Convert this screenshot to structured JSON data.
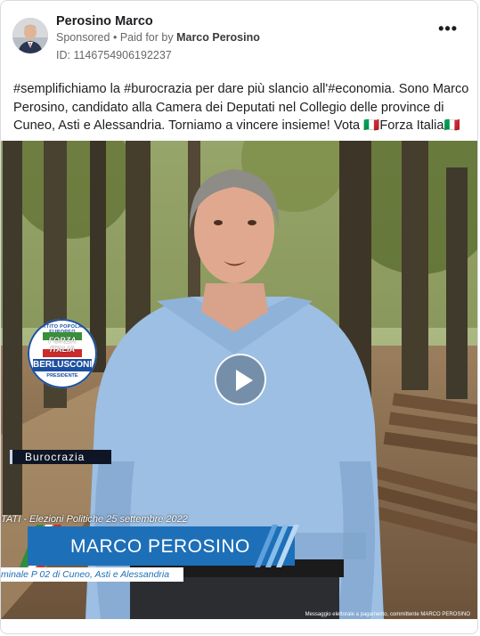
{
  "header": {
    "page_name": "Perosino Marco",
    "sponsored": "Sponsored",
    "separator": "•",
    "paid_for_prefix": "Paid for by",
    "paid_for_name": "Marco Perosino",
    "ad_id": "ID: 1146754906192237",
    "more_icon": "ellipsis-icon"
  },
  "post": {
    "text": "#semplifichiamo la #burocrazia per dare più slancio all'#economia. Sono Marco Perosino, candidato alla Camera dei Deputati nel Collegio delle province di Cuneo, Asti e Alessandria. Torniamo a vincere insieme! Vota 🇮🇹Forza Italia🇮🇹"
  },
  "video": {
    "topic_label": "Burocrazia",
    "election_line": "TATI - Elezioni Politiche 25 settembre 2022",
    "candidate_name": "MARCO PEROSINO",
    "collegio_line": "minale P 02 di Cuneo, Asti e Alessandria",
    "disclaimer": "Messaggio elettorale a pagamento, committente MARCO PEROSINO",
    "play_icon": "play-icon",
    "logo": {
      "top_text": "PARTITO POPOLARE EUROPEO",
      "party_line1": "FORZA",
      "party_line2": "ITALIA",
      "leader": "BERLUSCONI",
      "role": "PRESIDENTE"
    }
  },
  "colors": {
    "accent_blue": "#1d6fb8",
    "text_primary": "#1c1e21",
    "text_secondary": "#65676b"
  }
}
